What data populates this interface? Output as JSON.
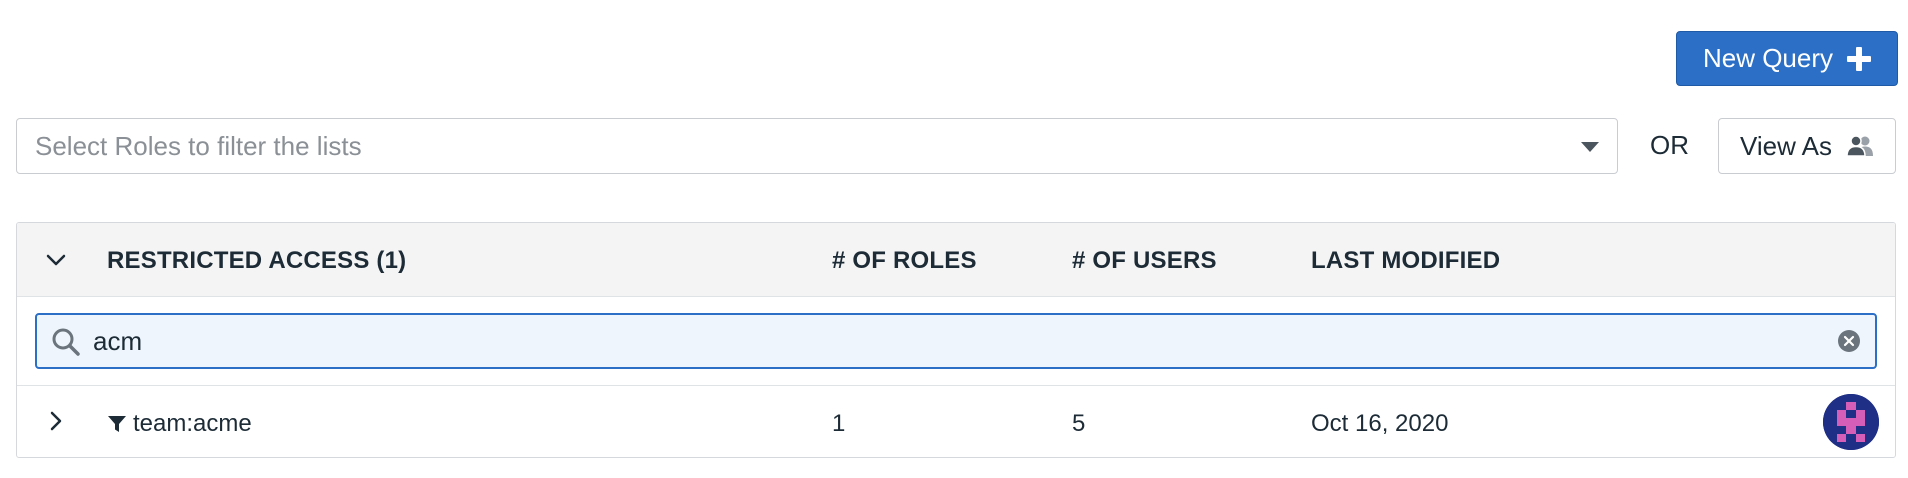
{
  "toolbar": {
    "new_query_label": "New Query",
    "select_placeholder": "Select Roles to filter the lists",
    "or_label": "OR",
    "view_as_label": "View As"
  },
  "table": {
    "section_title": "RESTRICTED ACCESS (1)",
    "columns": [
      "# OF ROLES",
      "# OF USERS",
      "LAST MODIFIED"
    ],
    "search": {
      "value": "acm"
    },
    "rows": [
      {
        "name": "team:acme",
        "roles": "1",
        "users": "5",
        "last_modified": "Oct 16, 2020"
      }
    ]
  },
  "colors": {
    "primary": "#2b6fc6",
    "header_bg": "#f4f4f4",
    "search_bg": "#eef5fc",
    "avatar_bg": "#1f2f86",
    "avatar_fg": "#d55fb8"
  },
  "icons": [
    "plus-icon",
    "caret-down-icon",
    "users-icon",
    "chevron-down-icon",
    "search-icon",
    "clear-icon",
    "chevron-right-icon",
    "filter-icon",
    "avatar"
  ]
}
